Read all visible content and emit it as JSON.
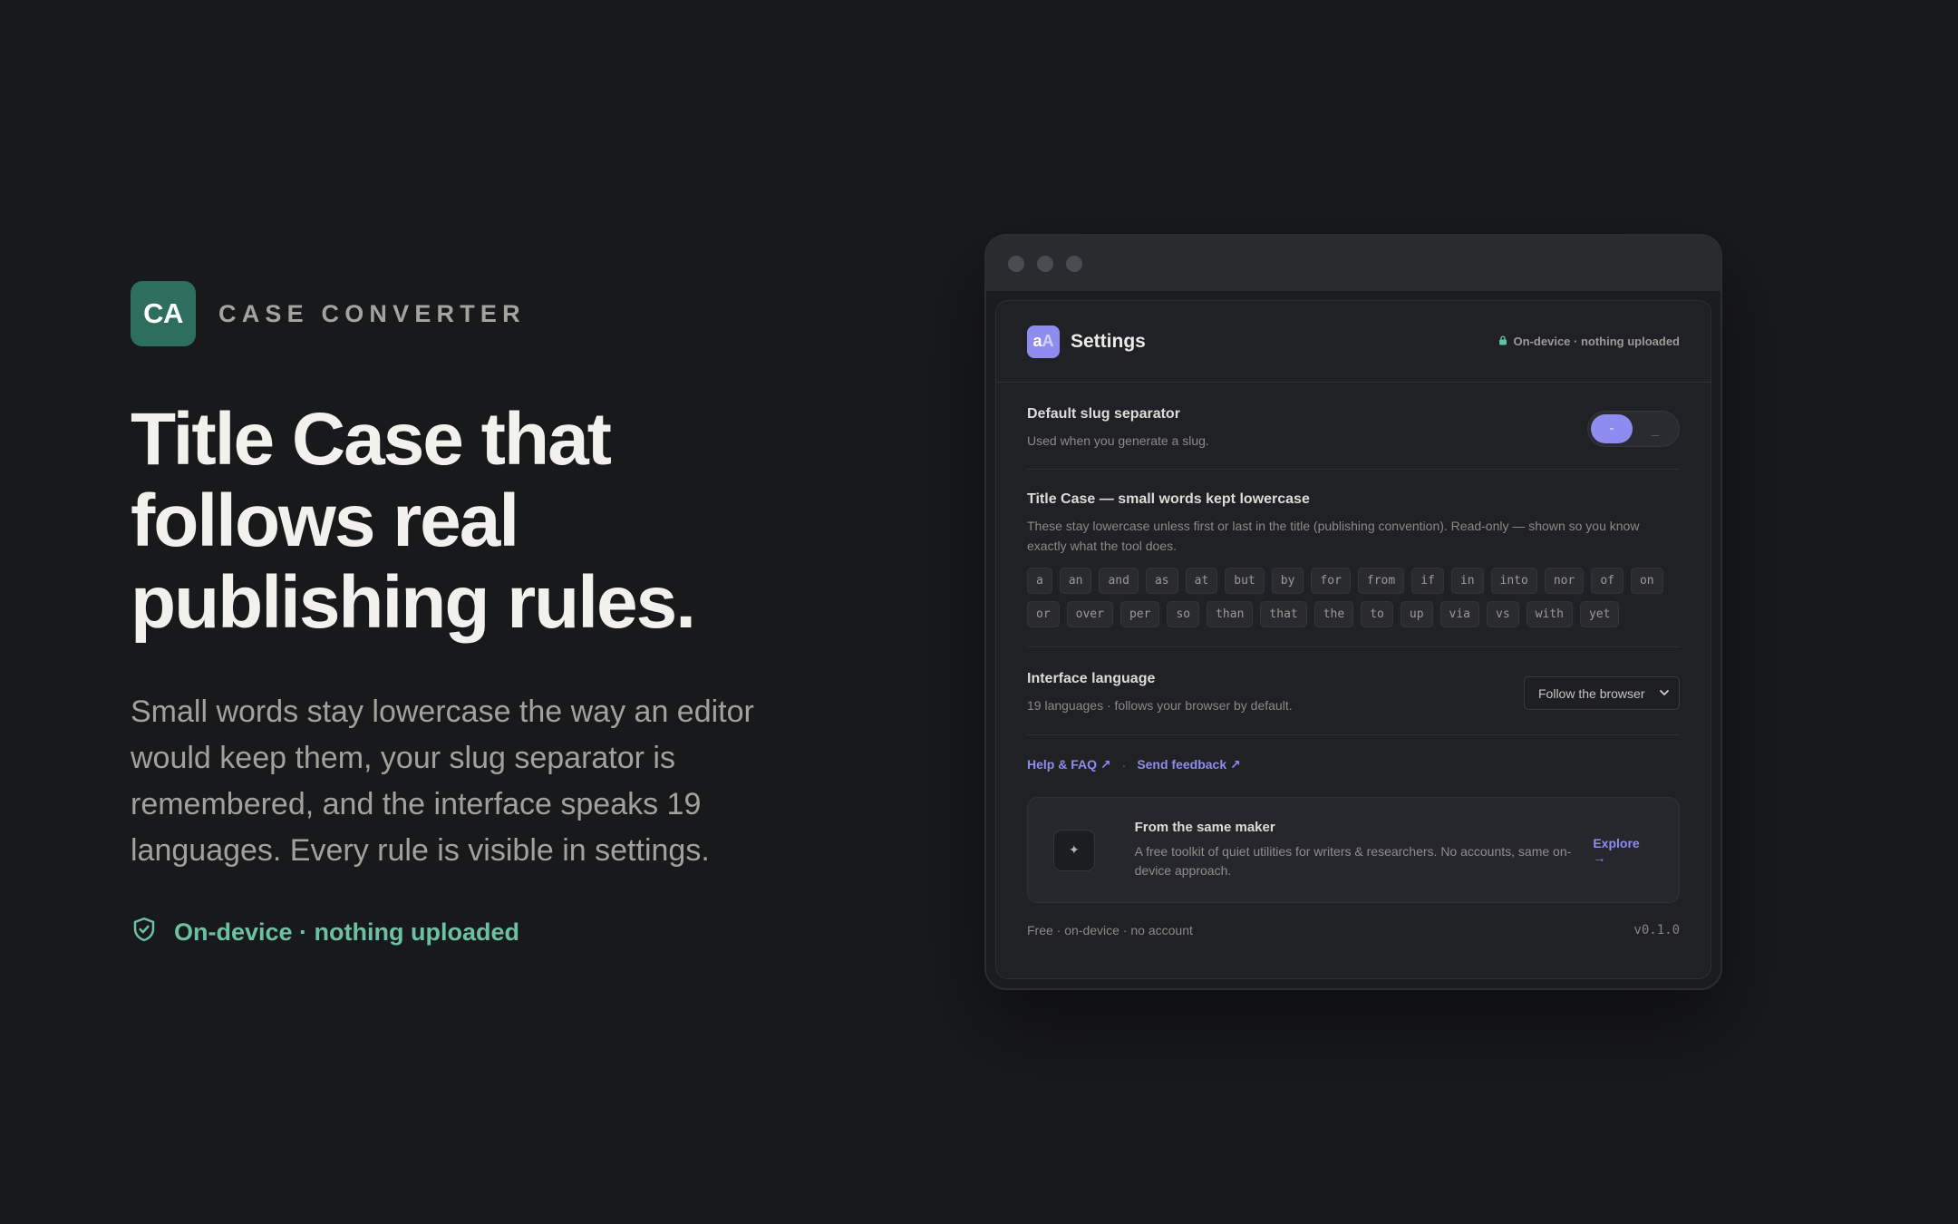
{
  "brand": {
    "mark": "CA",
    "name": "CASE CONVERTER"
  },
  "hero": {
    "title_lines": [
      "Title Case that",
      "follows real",
      "publishing rules."
    ],
    "subtitle": "Small words stay lowercase the way an editor would keep them, your slug separator is remembered, and the interface speaks 19 languages. Every rule is visible in settings.",
    "badge": "On-device · nothing uploaded",
    "badge_icon": "shield-check-icon"
  },
  "window": {
    "app_icon": {
      "main": "a",
      "accent": "A"
    },
    "title": "Settings",
    "status": "On-device · nothing uploaded",
    "slug": {
      "title": "Default slug separator",
      "desc": "Used when you generate a slug.",
      "options": [
        "-",
        "_"
      ],
      "selected": "-"
    },
    "title_case": {
      "title": "Title Case — small words kept lowercase",
      "desc": "These stay lowercase unless first or last in the title (publishing convention). Read-only — shown so you know exactly what the tool does.",
      "words": [
        "a",
        "an",
        "and",
        "as",
        "at",
        "but",
        "by",
        "for",
        "from",
        "if",
        "in",
        "into",
        "nor",
        "of",
        "on",
        "or",
        "over",
        "per",
        "so",
        "than",
        "that",
        "the",
        "to",
        "up",
        "via",
        "vs",
        "with",
        "yet"
      ]
    },
    "language": {
      "title": "Interface language",
      "desc": "19 languages · follows your browser by default.",
      "selected": "Follow the browser"
    },
    "links": {
      "help": "Help & FAQ ↗",
      "separator": "·",
      "feedback": "Send feedback ↗"
    },
    "maker": {
      "icon": "✦",
      "title": "From the same maker",
      "desc": "A free toolkit of quiet utilities for writers & researchers. No accounts, same on-device approach.",
      "cta": "Explore →"
    },
    "footer": {
      "left": "Free · on-device · no account",
      "version": "v0.1.0"
    }
  },
  "colors": {
    "background": "#18191b",
    "brand_green": "#2e6e5e",
    "accent_purple": "#8f8cf0",
    "badge_teal": "#6cc1a4"
  }
}
